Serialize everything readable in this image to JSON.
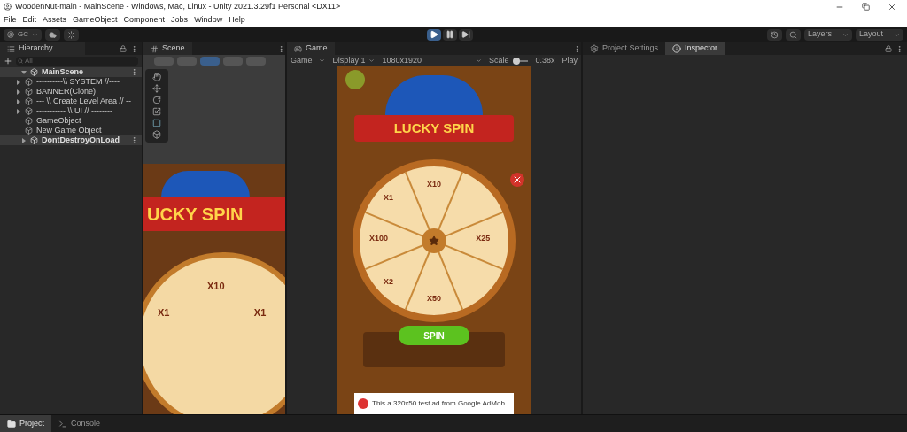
{
  "window": {
    "title": "WoodenNut-main - MainScene - Windows, Mac, Linux - Unity 2021.3.29f1 Personal <DX11>"
  },
  "menu": [
    "File",
    "Edit",
    "Assets",
    "GameObject",
    "Component",
    "Jobs",
    "Window",
    "Help"
  ],
  "toolbar": {
    "account": "GC",
    "play_controls": [
      {
        "kind": "play",
        "selected": true
      },
      {
        "kind": "pause",
        "selected": false
      },
      {
        "kind": "step",
        "selected": false
      }
    ],
    "dropdowns": [
      "Layers",
      "Layout"
    ]
  },
  "hierarchy": {
    "title": "Hierarchy",
    "placeholder": "All",
    "scenes": [
      {
        "name": "MainScene",
        "expanded": true,
        "children": [
          {
            "name": "----------\\\\ SYSTEM //----",
            "expandable": true
          },
          {
            "name": "BANNER(Clone)",
            "expandable": true
          },
          {
            "name": "--- \\\\ Create Level Area // --",
            "expandable": true
          },
          {
            "name": "----------- \\\\ UI // --------",
            "expandable": true
          },
          {
            "name": "GameObject",
            "expandable": false
          },
          {
            "name": "New Game Object",
            "expandable": false
          }
        ]
      },
      {
        "name": "DontDestroyOnLoad",
        "expanded": false
      }
    ]
  },
  "scene": {
    "title": "Scene",
    "banner": "UCKY SPIN",
    "wheel_labels": [
      "X10",
      "X1",
      "X1"
    ]
  },
  "game": {
    "title": "Game",
    "mode": "Game",
    "display": "Display 1",
    "resolution": "1080x1920",
    "scale_label": "Scale",
    "scale": "0.38x",
    "play_label": "Play",
    "scale_slider": {
      "level": 0.05
    },
    "banner": "LUCKY SPIN",
    "wheel_labels": [
      "X10",
      "X1",
      "X25",
      "X100",
      "X2",
      "X50"
    ],
    "button": "SPIN",
    "ad": "This a 320x50 test ad from Google AdMob."
  },
  "inspector_tabs": [
    {
      "label": "Project Settings",
      "kind": "settings",
      "selected": false
    },
    {
      "label": "Inspector",
      "kind": "info",
      "selected": true
    }
  ],
  "bottom_tabs": [
    {
      "label": "Project",
      "kind": "folder",
      "selected": true
    },
    {
      "label": "Console",
      "kind": "console",
      "selected": false
    }
  ]
}
